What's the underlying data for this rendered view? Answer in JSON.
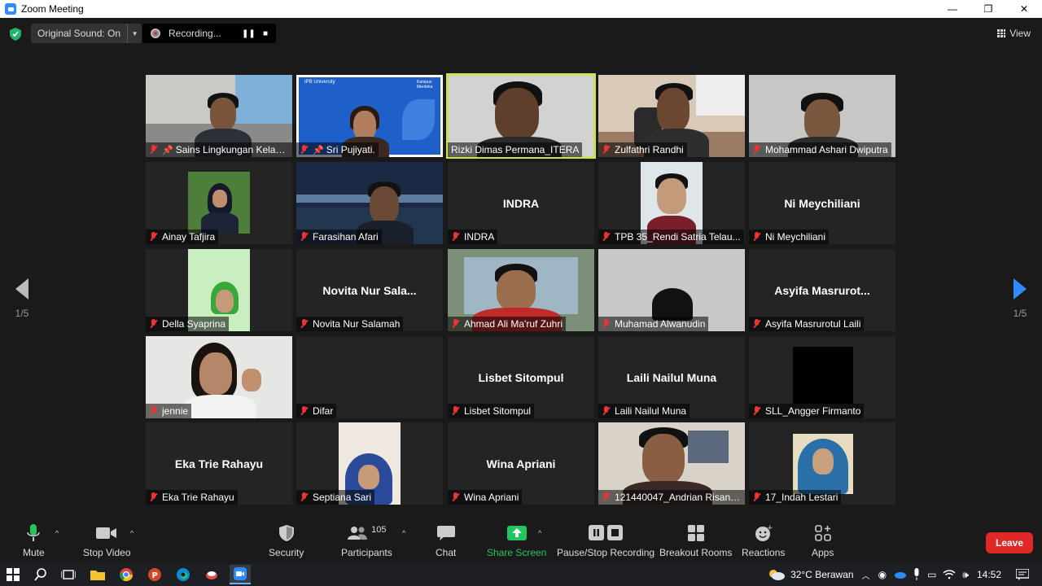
{
  "window": {
    "title": "Zoom Meeting",
    "min": "—",
    "max": "❐",
    "close": "✕"
  },
  "topbar": {
    "original_sound": "Original Sound: On",
    "recording": "Recording...",
    "view": "View"
  },
  "nav": {
    "left_page": "1/5",
    "right_page": "1/5"
  },
  "participants": [
    {
      "name": "Sains Lingkungan Kelaut...",
      "big": "",
      "pinned": true
    },
    {
      "name": "Sri Pujiyati.",
      "big": "",
      "pinned": true
    },
    {
      "name": "Rizki Dimas Permana_ITERA",
      "big": "",
      "speaking": true
    },
    {
      "name": "Zulfathri Randhi",
      "big": ""
    },
    {
      "name": "Mohammad Ashari Dwiputra",
      "big": ""
    },
    {
      "name": "Ainay Tafjira",
      "big": ""
    },
    {
      "name": "Farasihan Afari",
      "big": ""
    },
    {
      "name": "INDRA",
      "big": "INDRA"
    },
    {
      "name": "TPB 35_Rendi Satria Telau...",
      "big": ""
    },
    {
      "name": "Ni Meychiliani",
      "big": "Ni Meychiliani"
    },
    {
      "name": "Della Syaprina",
      "big": ""
    },
    {
      "name": "Novita Nur Salamah",
      "big": "Novita Nur Sala..."
    },
    {
      "name": "Ahmad Ali Ma'ruf Zuhri",
      "big": ""
    },
    {
      "name": "Muhamad Alwanudin",
      "big": ""
    },
    {
      "name": "Asyifa Masrurotul Laili",
      "big": "Asyifa Masrurot..."
    },
    {
      "name": "jennie",
      "big": ""
    },
    {
      "name": "Difar",
      "big": ""
    },
    {
      "name": "Lisbet Sitompul",
      "big": "Lisbet Sitompul"
    },
    {
      "name": "Laili Nailul Muna",
      "big": "Laili Nailul Muna"
    },
    {
      "name": "SLL_Angger Firmanto",
      "big": ""
    },
    {
      "name": "Eka Trie Rahayu",
      "big": "Eka Trie Rahayu"
    },
    {
      "name": "Septiana Sari",
      "big": ""
    },
    {
      "name": "Wina Apriani",
      "big": "Wina Apriani"
    },
    {
      "name": "121440047_Andrian Risand...",
      "big": ""
    },
    {
      "name": "17_Indah Lestari",
      "big": ""
    }
  ],
  "slide": {
    "title": "IPB University",
    "subtitle": "Kampus Merdeka"
  },
  "toolbar": {
    "mute": "Mute",
    "stop_video": "Stop Video",
    "security": "Security",
    "participants": "Participants",
    "participants_count": "105",
    "chat": "Chat",
    "share_screen": "Share Screen",
    "pause_stop_recording": "Pause/Stop Recording",
    "breakout_rooms": "Breakout Rooms",
    "reactions": "Reactions",
    "apps": "Apps",
    "leave": "Leave"
  },
  "taskbar": {
    "weather": "32°C  Berawan",
    "time": "14:52"
  },
  "colors": {
    "accent": "#2d8cff",
    "leave": "#e02828",
    "share": "#22c55e",
    "speaking": "#cde05a",
    "muted_mic": "#e33333"
  }
}
